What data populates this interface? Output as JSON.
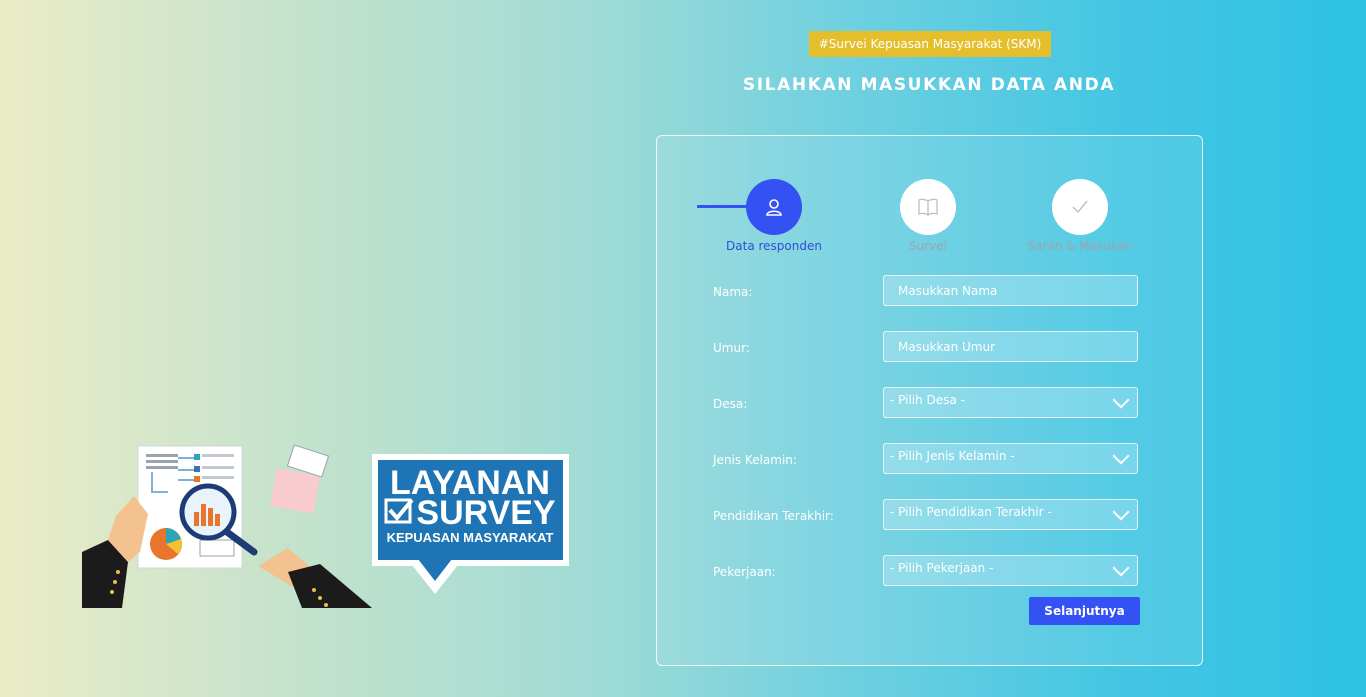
{
  "header": {
    "tag": "#Survei Kepuasan Masyarakat (SKM)",
    "title": "SILAHKAN MASUKKAN DATA ANDA"
  },
  "steps": [
    {
      "label": "Data responden",
      "icon": "user-icon",
      "active": true
    },
    {
      "label": "Survei",
      "icon": "book-icon",
      "active": false
    },
    {
      "label": "Saran & Masukan",
      "icon": "check-icon",
      "active": false
    }
  ],
  "form": {
    "nama": {
      "label": "Nama:",
      "placeholder": "Masukkan Nama"
    },
    "umur": {
      "label": "Umur:",
      "placeholder": "Masukkan Umur"
    },
    "desa": {
      "label": "Desa:",
      "selected": "- Pilih Desa -"
    },
    "jenis_kelamin": {
      "label": "Jenis Kelamin:",
      "selected": "- Pilih Jenis Kelamin -"
    },
    "pendidikan": {
      "label": "Pendidikan Terakhir:",
      "selected": "- Pilih Pendidikan Terakhir -"
    },
    "pekerjaan": {
      "label": "Pekerjaan:",
      "selected": "- Pilih Pekerjaan -"
    },
    "submit_label": "Selanjutnya"
  },
  "badge": {
    "line1": "LAYANAN",
    "line2": "SURVEY",
    "line3": "KEPUASAN MASYARAKAT"
  },
  "colors": {
    "accent": "#3451f4",
    "tag": "#e5be2b",
    "badge_blue": "#1f74b5"
  }
}
